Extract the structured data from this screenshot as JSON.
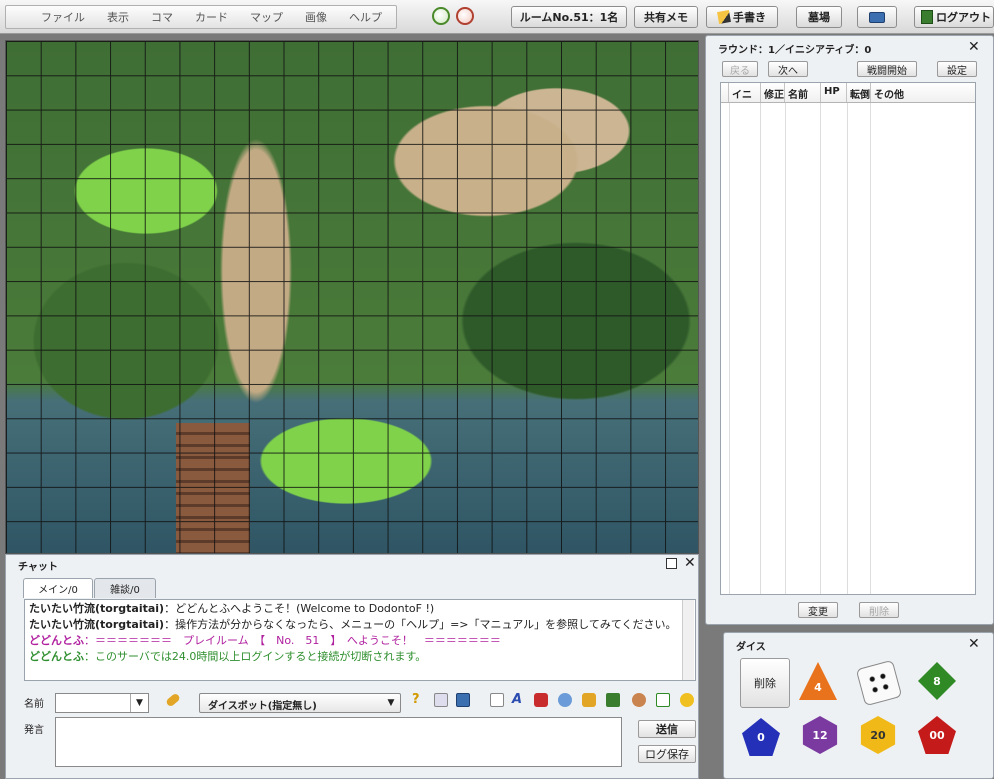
{
  "menu": {
    "items": [
      "ファイル",
      "表示",
      "コマ",
      "カード",
      "マップ",
      "画像",
      "ヘルプ"
    ]
  },
  "toolbar": {
    "room_label": "ルームNo.51：1名",
    "memo_label": "共有メモ",
    "draw_label": "手書き",
    "grave_label": "墓場",
    "logout_label": "ログアウト"
  },
  "initiative": {
    "title": "ラウンド：1／イニシアティブ：0",
    "back_label": "戻る",
    "next_label": "次へ",
    "start_label": "戦闘開始",
    "settings_label": "設定",
    "columns": [
      "イニ",
      "修正",
      "名前",
      "HP",
      "転倒",
      "その他"
    ],
    "change_label": "変更",
    "delete_label": "削除"
  },
  "chat": {
    "title": "チャット",
    "tabs": [
      "メイン/0",
      "雑談/0"
    ],
    "messages": [
      {
        "name": "たいたい竹流(torgtaitai)",
        "text": "：どどんとふへようこそ！(Welcome to DodontoF !)"
      },
      {
        "name": "たいたい竹流(torgtaitai)",
        "text": "：操作方法が分からなくなったら、メニューの「ヘルプ」=>「マニュアル」を参照してみてください。"
      },
      {
        "name": "どどんとふ",
        "text": "：＝＝＝＝＝＝＝　プレイルーム　【　No.　51　】　へようこそ！　＝＝＝＝＝＝＝"
      },
      {
        "name": "どどんとふ",
        "text": "：このサーバでは24.0時間以上ログインすると接続が切断されます。"
      }
    ],
    "name_label": "名前",
    "name_value": "",
    "dicebot_value": "ダイスボット(指定無し)",
    "speech_label": "発言",
    "speech_value": "",
    "send_label": "送信",
    "save_log_label": "ログ保存"
  },
  "dice_panel": {
    "title": "ダイス",
    "delete_label": "削除",
    "dice": [
      {
        "name": "d4",
        "face": "4",
        "color": "#e8731c"
      },
      {
        "name": "d6",
        "face": "",
        "color": "#ffffff"
      },
      {
        "name": "d8",
        "face": "8",
        "color": "#2f8a25"
      },
      {
        "name": "d10",
        "face": "0",
        "color": "#2430b8"
      },
      {
        "name": "d12",
        "face": "12",
        "color": "#7a3aa0"
      },
      {
        "name": "d20",
        "face": "20",
        "color": "#f0b918"
      },
      {
        "name": "d100",
        "face": "00",
        "color": "#c41a1a"
      }
    ]
  }
}
